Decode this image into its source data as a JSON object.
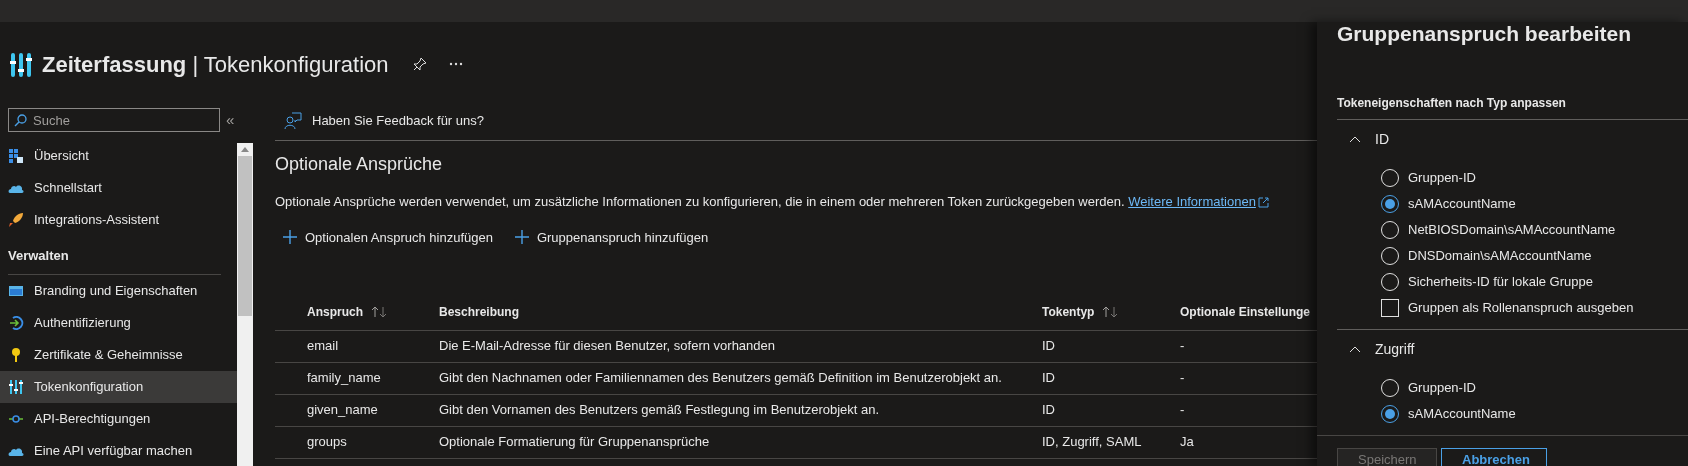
{
  "header": {
    "title": "**Zeiterfassung** | Tokenkonfiguration"
  },
  "sidebar": {
    "search": {
      "placeholder": "Suche"
    },
    "collapse": "«",
    "items": [
      {
        "kind": "item",
        "label": "Übersicht",
        "selected": false
      },
      {
        "kind": "item",
        "label": "Schnellstart",
        "selected": false
      },
      {
        "kind": "item",
        "label": "Integrations-Assistent",
        "selected": false
      },
      {
        "kind": "section",
        "label": "Verwalten"
      },
      {
        "kind": "item",
        "label": "Branding und Eigenschaften",
        "selected": false
      },
      {
        "kind": "item",
        "label": "Authentifizierung",
        "selected": false
      },
      {
        "kind": "item",
        "label": "Zertifikate & Geheimnisse",
        "selected": false
      },
      {
        "kind": "item",
        "label": "Tokenkonfiguration",
        "selected": true
      },
      {
        "kind": "item",
        "label": "API-Berechtigungen",
        "selected": false
      },
      {
        "kind": "item",
        "label": "Eine API verfügbar machen",
        "selected": false
      }
    ]
  },
  "main": {
    "feedback": "Haben Sie Feedback für uns?",
    "heading": "Optionale Ansprüche",
    "description": "Optionale Ansprüche werden verwendet, um zusätzliche Informationen zu konfigurieren, die in einem oder mehreren Token zurückgegeben werden.",
    "link": "Weitere Informationen",
    "actions": [
      "Optionalen Anspruch hinzufügen",
      "Gruppenanspruch hinzufügen"
    ],
    "table": {
      "columns": [
        {
          "label": "Anspruch",
          "sortable": true
        },
        {
          "label": "Beschreibung",
          "sortable": false
        },
        {
          "label": "Tokentyp",
          "sortable": true
        },
        {
          "label": "Optionale Einstellunge"
        }
      ],
      "rows": [
        [
          "email",
          "Die E-Mail-Adresse für diesen Benutzer, sofern vorhanden",
          "ID",
          "-"
        ],
        [
          "family_name",
          "Gibt den Nachnamen oder Familiennamen des Benutzers gemäß Definition im Benutzerobjekt an.",
          "ID",
          "-"
        ],
        [
          "given_name",
          "Gibt den Vornamen des Benutzers gemäß Festlegung im Benutzerobjekt an.",
          "ID",
          "-"
        ],
        [
          "groups",
          "Optionale Formatierung für Gruppenansprüche",
          "ID, Zugriff, SAML",
          "Ja"
        ]
      ]
    }
  },
  "panel": {
    "title": "Gruppenanspruch bearbeiten",
    "subtitle": "Tokeneigenschaften nach Typ anpassen",
    "sections": [
      {
        "label": "ID",
        "expanded": true,
        "options": [
          {
            "kind": "radio",
            "label": "Gruppen-ID",
            "checked": false
          },
          {
            "kind": "radio",
            "label": "sAMAccountName",
            "checked": true
          },
          {
            "kind": "radio",
            "label": "NetBIOSDomain\\sAMAccountName",
            "checked": false
          },
          {
            "kind": "radio",
            "label": "DNSDomain\\sAMAccountName",
            "checked": false
          },
          {
            "kind": "radio",
            "label": "Sicherheits-ID für lokale Gruppe",
            "checked": false
          },
          {
            "kind": "checkbox",
            "label": "Gruppen als Rollenanspruch ausgeben",
            "checked": false
          }
        ]
      },
      {
        "label": "Zugriff",
        "expanded": true,
        "options": [
          {
            "kind": "radio",
            "label": "Gruppen-ID",
            "checked": false
          },
          {
            "kind": "radio",
            "label": "sAMAccountName",
            "checked": true
          }
        ]
      }
    ],
    "buttons": [
      {
        "label": "Speichern",
        "disabled": true
      },
      {
        "label": "Abbrechen",
        "disabled": false
      }
    ]
  }
}
